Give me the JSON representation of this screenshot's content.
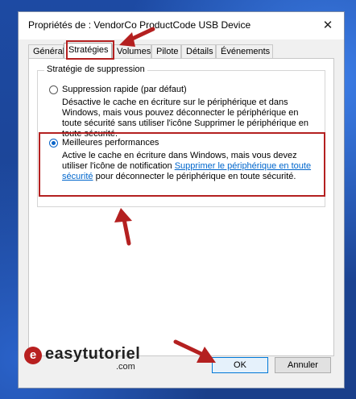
{
  "window": {
    "title": "Propriétés de : VendorCo ProductCode USB Device",
    "close_glyph": "✕"
  },
  "tabs": [
    {
      "label": "Général"
    },
    {
      "label": "Stratégies"
    },
    {
      "label": "Volumes"
    },
    {
      "label": "Pilote"
    },
    {
      "label": "Détails"
    },
    {
      "label": "Événements"
    }
  ],
  "active_tab": "Stratégies",
  "group": {
    "legend": "Stratégie de suppression"
  },
  "options": [
    {
      "label": "Suppression rapide (par défaut)",
      "selected": false,
      "description": "Désactive le cache en écriture sur le périphérique et dans Windows, mais vous pouvez déconnecter le périphérique en toute sécurité sans utiliser l'icône Supprimer le périphérique en toute sécurité."
    },
    {
      "label": "Meilleures performances",
      "selected": true,
      "description_part1": "Active le cache en écriture dans Windows, mais vous devez utiliser l'icône de notification",
      "link": "Supprimer le périphérique en toute sécurité",
      "description_part2": " pour déconnecter le périphérique en toute sécurité."
    }
  ],
  "buttons": {
    "ok": "OK",
    "cancel": "Annuler"
  },
  "watermark": {
    "brand": "easytutoriel",
    "suffix": ".com",
    "mark": "e"
  },
  "colors": {
    "highlight": "#b42020",
    "link": "#0066cc",
    "radio_selected": "#0a64c8"
  },
  "icons": [
    "close-icon",
    "radio-icon",
    "arrow-icon"
  ]
}
